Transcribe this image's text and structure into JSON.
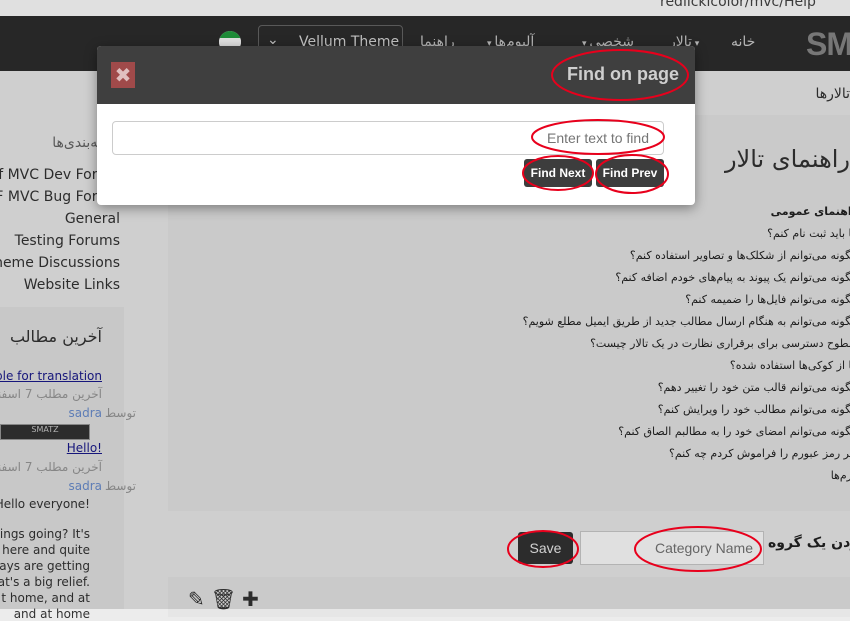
{
  "browser": {
    "url": "redlickicolor/mvc/Help"
  },
  "navbar": {
    "logo": "SM",
    "links": [
      "خانه",
      "تالار",
      "شخصی",
      "آلبوم‌ها",
      "راهنما"
    ],
    "theme": "Vellum Theme"
  },
  "sidebar": {
    "heading": "دسته‌بندی‌ها",
    "categories": [
      "Yaf MVC Dev Forum",
      "YAF MVC Bug Forum",
      "General",
      "Testing Forums",
      "Theme Discussions",
      "Website Links"
    ]
  },
  "latest": {
    "title": "آخرین مطالب",
    "posts": [
      {
        "title": "ble for translation",
        "meta": "آخرین مطلب 7 اسفند",
        "by": "توسط",
        "user": "sadra"
      },
      {
        "title": "Hello!",
        "meta": "آخرین مطلب 7 اسفند",
        "by": "توسط",
        "user": "sadra"
      }
    ],
    "banner": "SMATZ",
    "excerpt": [
      "Hello everyone!",
      "ings going? It's",
      "r here and quite",
      "days are getting",
      "at's a big relief.",
      "t home, and at",
      "and at home"
    ]
  },
  "breadcrumb": "تالارها",
  "main": {
    "title": "راهنمای تالار",
    "faq": [
      "راهنمای عمومی",
      "آیا باید ثبت نام کنم؟",
      "چگونه می‌توانم از شکلک‌ها و تصاویر استفاده کنم؟",
      "چگونه می‌توانم یک پیوند به پیام‌های خودم اضافه کنم؟",
      "چگونه می‌توانم فایل‌ها را ضمیمه کنم؟",
      "چگونه می‌توانم به هنگام ارسال مطالب جدید از طریق ایمیل مطلع شویم؟",
      "سطوح دسترسی برای برقراری نظارت در یک تالار چیست؟",
      "آیا از کوکی‌ها استفاده شده؟",
      "چگونه می‌توانم قالب متن خود را تغییر دهم؟",
      "چگونه می‌توانم مطالب خود را ویرایش کنم؟",
      "چگونه می‌توانم امضای خود را به مطالبم الصاق کنم؟",
      "اگر رمز عبورم را فراموش کردم چه کنم؟",
      "فرم‌ها"
    ]
  },
  "category_form": {
    "save_label": "Save",
    "placeholder": "Category Name",
    "add_label": "افزودن یک گروه"
  },
  "find_dialog": {
    "title": "Find on page",
    "close_glyph": "✖",
    "placeholder": "Enter text to find",
    "next_label": "Find Next",
    "prev_label": "Find Prev"
  },
  "colors": {
    "navbar": "#2d2d2d",
    "modal_header": "#3f3f3f",
    "annotation": "#e8001c"
  }
}
